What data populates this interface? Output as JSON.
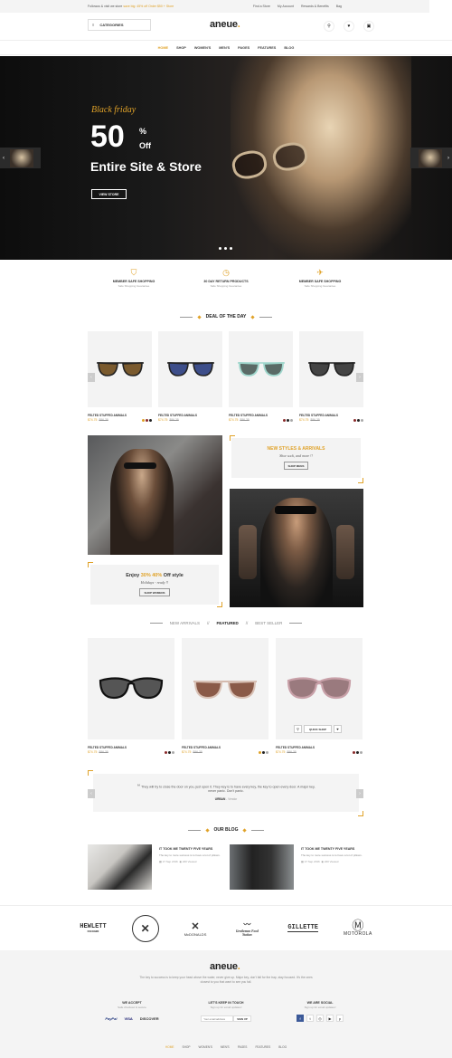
{
  "topbar": {
    "promo_prefix": "Followus & visit we store",
    "promo_highlight": "save big: 45% off Order $50 + Store",
    "links": [
      "Find a Store",
      "My Account",
      "Rewards & Benefits",
      "Bag"
    ]
  },
  "header": {
    "categories_label": "CATEGORIES",
    "logo": "aneue",
    "logo_dot": "."
  },
  "nav": {
    "items": [
      "HOME",
      "SHOP",
      "WOMEN'S",
      "MEN'S",
      "PAGES",
      "FEATURES",
      "BLOG"
    ]
  },
  "hero": {
    "tagline": "Black friday",
    "discount": "50",
    "percent": "%",
    "off": "Off",
    "headline": "Entire Site & Store",
    "button": "VIEW STORE"
  },
  "features": [
    {
      "icon": "shield-icon",
      "title": "MEMBER SAFE SHOPPING",
      "sub": "Safe Shopping Guarantee"
    },
    {
      "icon": "clock-icon",
      "title": "30 DAY RETURN PRODUCTS",
      "sub": "Safe Shopping Guarantee"
    },
    {
      "icon": "plane-icon",
      "title": "MEMBER SAFE SHOPPING",
      "sub": "Safe Shopping Guarantee"
    }
  ],
  "deal": {
    "title": "DEAL OF THE DAY",
    "products": [
      {
        "name": "FELTED STUFFED ANIMALS",
        "price": "$74.75",
        "old": "$86.35"
      },
      {
        "name": "FELTED STUFFED ANIMALS",
        "price": "$74.75",
        "old": "$86.35"
      },
      {
        "name": "FELTED STUFFED ANIMALS",
        "price": "$74.75",
        "old": "$86.35"
      },
      {
        "name": "FELTED STUFFED ANIMALS",
        "price": "$74.75",
        "old": "$86.35"
      }
    ]
  },
  "promo": {
    "a_title": "NEW STYLES & ARRIVALS",
    "a_sub": "Shoe sock, and more !!",
    "a_button": "SHOP MENS",
    "b_title_prefix": "Enjoy",
    "b_highlight": "30% 40%",
    "b_title_suffix": "Off style",
    "b_sub": "Holidays - ready !!",
    "b_button": "SHOP WOMENS"
  },
  "tabs": {
    "items": [
      "NEW ARRIVALS",
      "FEATURED",
      "BEST SELLER"
    ],
    "sep": "//"
  },
  "featured": {
    "quick_shop": "QUICK SHOP",
    "products": [
      {
        "name": "FELTED STUFFED ANIMALS",
        "price": "$74.75",
        "old": "$86.35"
      },
      {
        "name": "FELTED STUFFED ANIMALS",
        "price": "$74.75",
        "old": "$86.35"
      },
      {
        "name": "FELTED STUFFED ANIMALS",
        "price": "$74.75",
        "old": "$86.35"
      }
    ]
  },
  "testimonial": {
    "quote": "They will try to close the door on you, just open it. They key is to have every key, the key to open every door. A major key, never panic. Don't panic.",
    "author": "URBAN",
    "role": "- Vendor"
  },
  "blog": {
    "title": "OUR BLOG",
    "posts": [
      {
        "title": "IT TOOK ME TWENTY FIVE YEARS",
        "desc": "The key to more success is to have a lot of pillows.",
        "date": "17 Sep 2016",
        "views": "220 Viewed"
      },
      {
        "title": "IT TOOK ME TWENTY FIVE YEARS",
        "desc": "The key to more success is to have a lot of pillows.",
        "date": "17 Sep 2016",
        "views": "220 Viewed"
      }
    ]
  },
  "brands": [
    "HEWLETT",
    "PACKARD",
    "McDONALDS",
    "Gentleman Food Station",
    "GILLETTE",
    "MOTOROLA"
  ],
  "footer": {
    "logo": "aneue",
    "logo_dot": ".",
    "about": "The key to success is to keep your head above the water, never give up. Major key, don't fall for the trap, stay focused. It's the ones closest to you that want to see you fail.",
    "accept_title": "WE ACCEPT",
    "accept_sub": "Safe checkout & secure",
    "payments": [
      "PayPal",
      "VISA",
      "DISCOVER"
    ],
    "touch_title": "LET'S KEEP IN TOUCH",
    "touch_sub": "Sign up for email updates!",
    "email_placeholder": "Your email address",
    "signup": "SIGN UP",
    "social_title": "WE ARE SOCIAL",
    "social_sub": "Sign up for email updates!",
    "nav": [
      "HOME",
      "SHOP",
      "WOMEN'S",
      "MEN'S",
      "PAGES",
      "FEATURES",
      "BLOG"
    ]
  },
  "colors": {
    "accent": "#e0a228",
    "dark": "#111111",
    "light_bg": "#f3f3f3"
  }
}
